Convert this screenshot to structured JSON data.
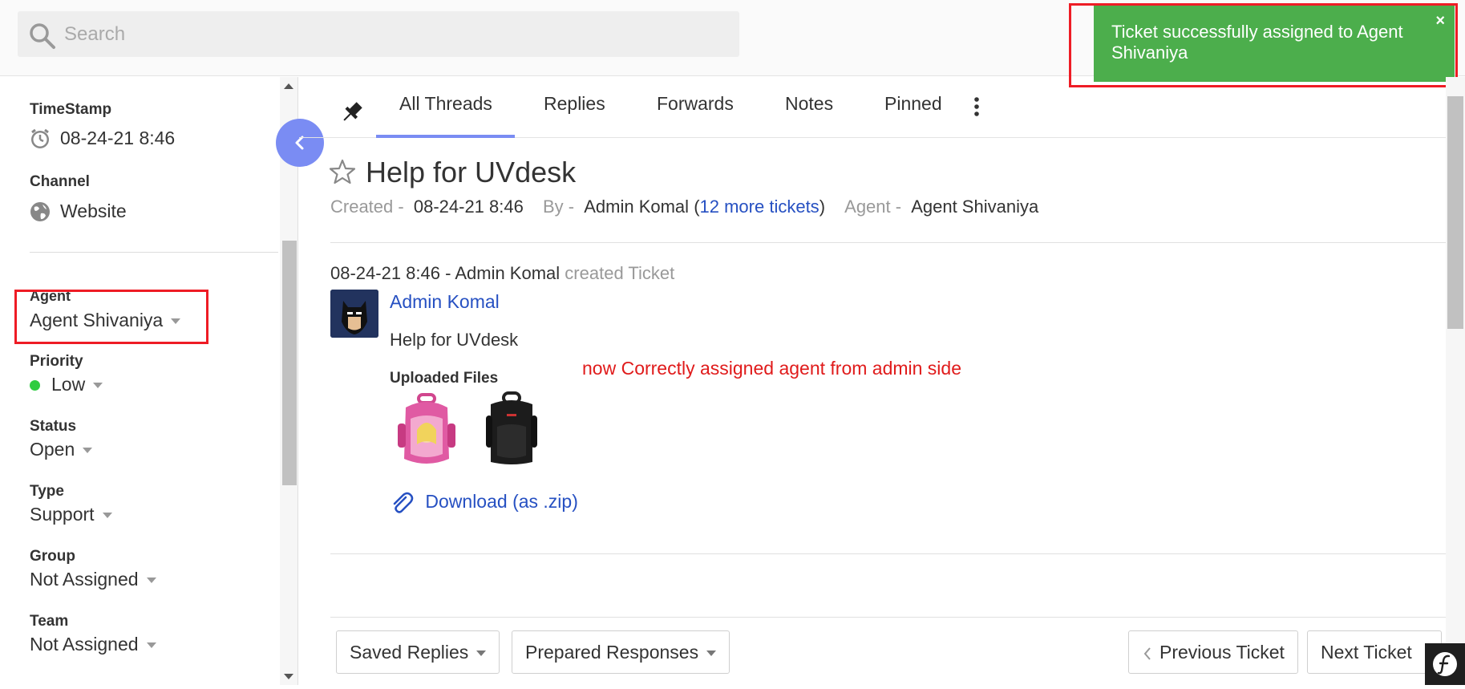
{
  "search": {
    "placeholder": "Search"
  },
  "toast": {
    "message": "Ticket successfully assigned to Agent Shivaniya",
    "close": "×"
  },
  "sidebar": {
    "timestamp": {
      "label": "TimeStamp",
      "value": "08-24-21 8:46"
    },
    "channel": {
      "label": "Channel",
      "value": "Website"
    },
    "agent": {
      "label": "Agent",
      "value": "Agent Shivaniya"
    },
    "priority": {
      "label": "Priority",
      "value": "Low",
      "color": "#2ecc40"
    },
    "status": {
      "label": "Status",
      "value": "Open"
    },
    "type": {
      "label": "Type",
      "value": "Support"
    },
    "group": {
      "label": "Group",
      "value": "Not Assigned"
    },
    "team": {
      "label": "Team",
      "value": "Not Assigned"
    }
  },
  "tabs": [
    "All Threads",
    "Replies",
    "Forwards",
    "Notes",
    "Pinned"
  ],
  "ticket": {
    "title": "Help for UVdesk",
    "created_label": "Created -",
    "created_value": "08-24-21 8:46",
    "by_label": "By -",
    "by_value": "Admin Komal",
    "more_tickets": "12 more tickets",
    "agent_label": "Agent -",
    "agent_value": "Agent Shivaniya"
  },
  "thread": {
    "header_time": "08-24-21 8:46 - Admin Komal",
    "header_action": "created Ticket",
    "author": "Admin Komal",
    "body": "Help for UVdesk",
    "uploaded_label": "Uploaded Files",
    "download": "Download (as .zip)"
  },
  "annotation": "now Correctly assigned agent from admin side",
  "toolbar": {
    "saved_replies": "Saved Replies",
    "prepared_responses": "Prepared Responses",
    "previous_ticket": "Previous Ticket",
    "next_ticket": "Next Ticket"
  },
  "colors": {
    "accent": "#7a8cf3",
    "link": "#2650c2",
    "toast": "#4cae4c",
    "annotation": "#e01b1b"
  }
}
